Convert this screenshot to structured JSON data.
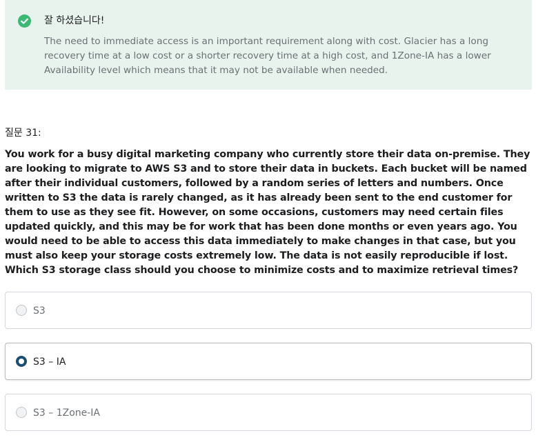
{
  "feedback": {
    "title": "잘 하셨습니다!",
    "text": "The need to immediate access is an important requirement along with cost. Glacier has a long recovery time at a low cost or a shorter recovery time at a high cost, and 1Zone-IA has a lower Availability level which means that it may not be available when needed.",
    "icon": "check-circle-icon",
    "color": "#3bb873",
    "background": "#e9f3ee"
  },
  "question": {
    "label": "질문 31:",
    "text": "You work for a busy digital marketing company who currently store their data on-premise. They are looking to migrate to AWS S3 and to store their data in buckets. Each bucket will be named after their individual customers, followed by a random series of letters and numbers. Once written to S3 the data is rarely changed, as it has already been sent to the end customer for them to use as they see fit. However, on some occasions, customers may need certain files updated quickly, and this may be for work that has been done months or even years ago. You would need to be able to access this data immediately to make changes in that case, but you must also keep your storage costs extremely low. The data is not easily reproducible if lost. Which S3 storage class should you choose to minimize costs and to maximize retrieval times?"
  },
  "options": [
    {
      "label": "S3",
      "selected": false
    },
    {
      "label": "S3 – IA",
      "selected": true
    },
    {
      "label": "S3 – 1Zone-IA",
      "selected": false
    }
  ],
  "colors": {
    "selected_radio": "#1a4f72",
    "text": "#1c1d1f",
    "muted_text": "#6a6f73"
  }
}
